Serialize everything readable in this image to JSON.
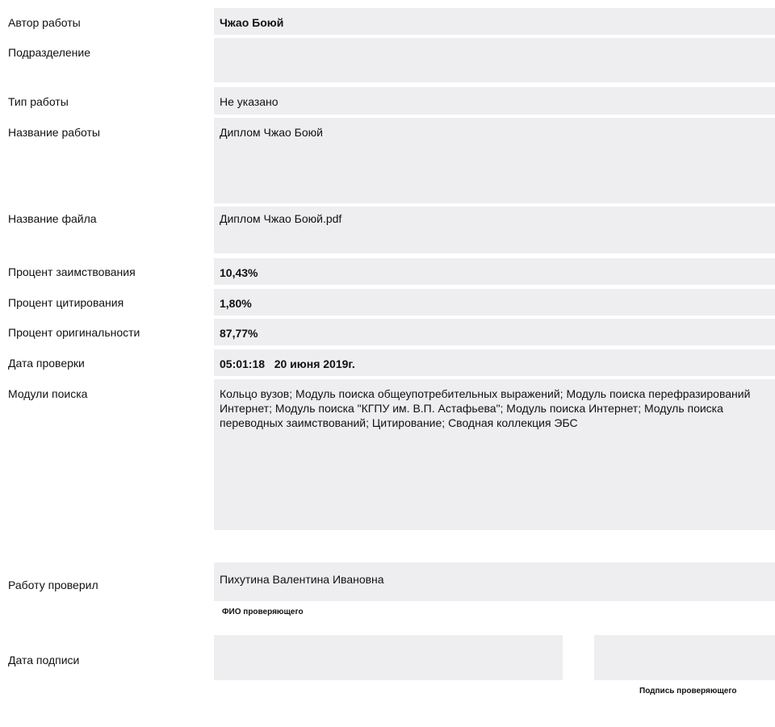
{
  "rows": {
    "author": {
      "label": "Автор работы",
      "value": "Чжао Боюй"
    },
    "department": {
      "label": "Подразделение",
      "value": ""
    },
    "work_type": {
      "label": "Тип работы",
      "value": "Не указано"
    },
    "work_title": {
      "label": "Название работы",
      "value": "Диплом Чжао Боюй"
    },
    "file_name": {
      "label": "Название файла",
      "value": "Диплом Чжао Боюй.pdf"
    },
    "borrowing_percent": {
      "label": "Процент заимствования",
      "value": "10,43%"
    },
    "citation_percent": {
      "label": "Процент цитирования",
      "value": "1,80%"
    },
    "originality_percent": {
      "label": "Процент оригинальности",
      "value": "87,77%"
    },
    "check_date": {
      "label": "Дата проверки",
      "value": "05:01:18   20 июня 2019г."
    },
    "search_modules": {
      "label": "Модули поиска",
      "value": "Кольцо вузов; Модуль поиска общеупотребительных выражений; Модуль поиска перефразирований Интернет; Модуль поиска \"КГПУ им. В.П. Астафьева\"; Модуль поиска Интернет; Модуль поиска переводных заимствований; Цитирование; Сводная коллекция ЭБС"
    },
    "checked_by": {
      "label": "Работу проверил",
      "value": "Пихутина Валентина Ивановна",
      "caption": "ФИО проверяющего"
    },
    "signature_date": {
      "label": "Дата подписи",
      "date_value": "",
      "signature_value": "",
      "signature_caption": "Подпись проверяющего"
    }
  }
}
